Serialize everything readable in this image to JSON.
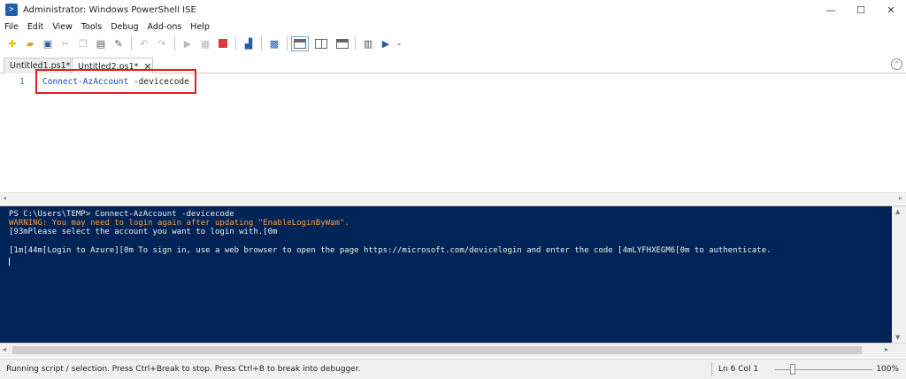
{
  "window": {
    "title": "Administrator: Windows PowerShell ISE",
    "minimize": "—",
    "maximize": "☐",
    "close": "✕"
  },
  "menu": [
    "File",
    "Edit",
    "View",
    "Tools",
    "Debug",
    "Add-ons",
    "Help"
  ],
  "toolbar": {
    "icons": [
      "new-file-icon",
      "open-folder-icon",
      "save-icon",
      "cut-icon",
      "copy-icon",
      "paste-icon",
      "clear-console-icon",
      "undo-icon",
      "redo-icon",
      "run-script-icon",
      "run-selection-icon",
      "stop-icon",
      "remote-powershell-icon",
      "start-powershell-icon",
      "show-script-pane-top-icon",
      "show-script-pane-right-icon",
      "show-script-pane-maximized-icon",
      "show-command-window-icon",
      "show-command-addon-icon"
    ],
    "overflow": "⌄"
  },
  "tabs": [
    {
      "label": "Untitled1.ps1*",
      "active": false
    },
    {
      "label": "Untitled2.ps1*",
      "active": true
    }
  ],
  "script": {
    "line_number": "1",
    "command": "Connect-AzAccount",
    "parameter": " -devicecode"
  },
  "console": {
    "lines": [
      {
        "text": "PS C:\\Users\\TEMP> Connect-AzAccount -devicecode",
        "kind": "normal"
      },
      {
        "text": "WARNING: You may need to login again after updating \"EnableLoginByWam\".",
        "kind": "warn"
      },
      {
        "text": "[93mPlease select the account you want to login with.[0m",
        "kind": "normal"
      },
      {
        "text": "",
        "kind": "normal"
      },
      {
        "text": "[1m[44m[Login to Azure][0m To sign in, use a web browser to open the page https://microsoft.com/devicelogin and enter the code [4mLYFHXEGM6[0m to authenticate.",
        "kind": "normal"
      }
    ]
  },
  "status": {
    "message": "Running script / selection.  Press Ctrl+Break to stop.  Press Ctrl+B to break into debugger.",
    "position": "Ln 6  Col 1",
    "zoom": "100%",
    "zoom_fraction": 0.18
  },
  "colors": {
    "console_bg": "#012456",
    "warning": "#ff9a3c",
    "cmdlet": "#1f44c8",
    "highlight_box": "#e02020"
  }
}
